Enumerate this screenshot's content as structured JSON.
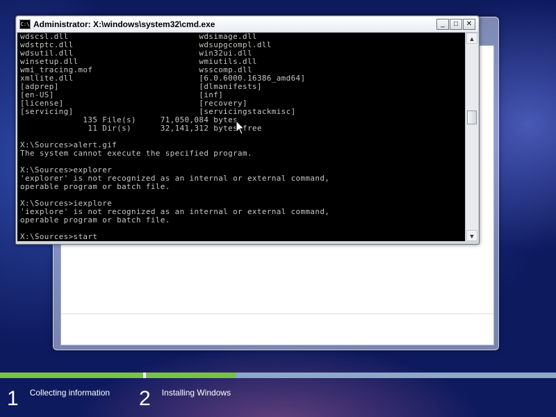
{
  "cmd": {
    "title": "Administrator: X:\\windows\\system32\\cmd.exe",
    "icon_label": "C:\\",
    "buttons": {
      "minimize": "_",
      "maximize": "□",
      "close": "✕"
    },
    "lines": [
      "wdscsl.dll                           wdsimage.dll",
      "wdstptc.dll                          wdsupgcompl.dll",
      "wdsutil.dll                          win32ui.dll",
      "winsetup.dll                         wmiutils.dll",
      "wmi_tracing.mof                      wsscomp.dll",
      "xmllite.dll                          [6.0.6000.16386_amd64]",
      "[adprep]                             [dlmanifests]",
      "[en-US]                              [inf]",
      "[license]                            [recovery]",
      "[servicing]                          [servicingstackmisc]",
      "             135 File(s)     71,050,084 bytes",
      "              11 Dir(s)      32,141,312 bytes free",
      "",
      "X:\\Sources>alert.gif",
      "The system cannot execute the specified program.",
      "",
      "X:\\Sources>explorer",
      "'explorer' is not recognized as an internal or external command,",
      "operable program or batch file.",
      "",
      "X:\\Sources>iexplore",
      "'iexplore' is not recognized as an internal or external command,",
      "operable program or batch file.",
      "",
      "X:\\Sources>start"
    ],
    "scrollbar": {
      "up": "▲",
      "down": "▼"
    }
  },
  "footer": {
    "progress": {
      "segment1_fill": 1.0,
      "segment2_fill": 0.22,
      "fill_color": "#7cc242",
      "track_color": "#8fa7c9"
    },
    "steps": [
      {
        "number": "1",
        "label": "Collecting information"
      },
      {
        "number": "2",
        "label": "Installing Windows"
      }
    ]
  },
  "icons": {
    "cursor": "mouse-pointer-icon",
    "cmd": "command-prompt-icon"
  }
}
